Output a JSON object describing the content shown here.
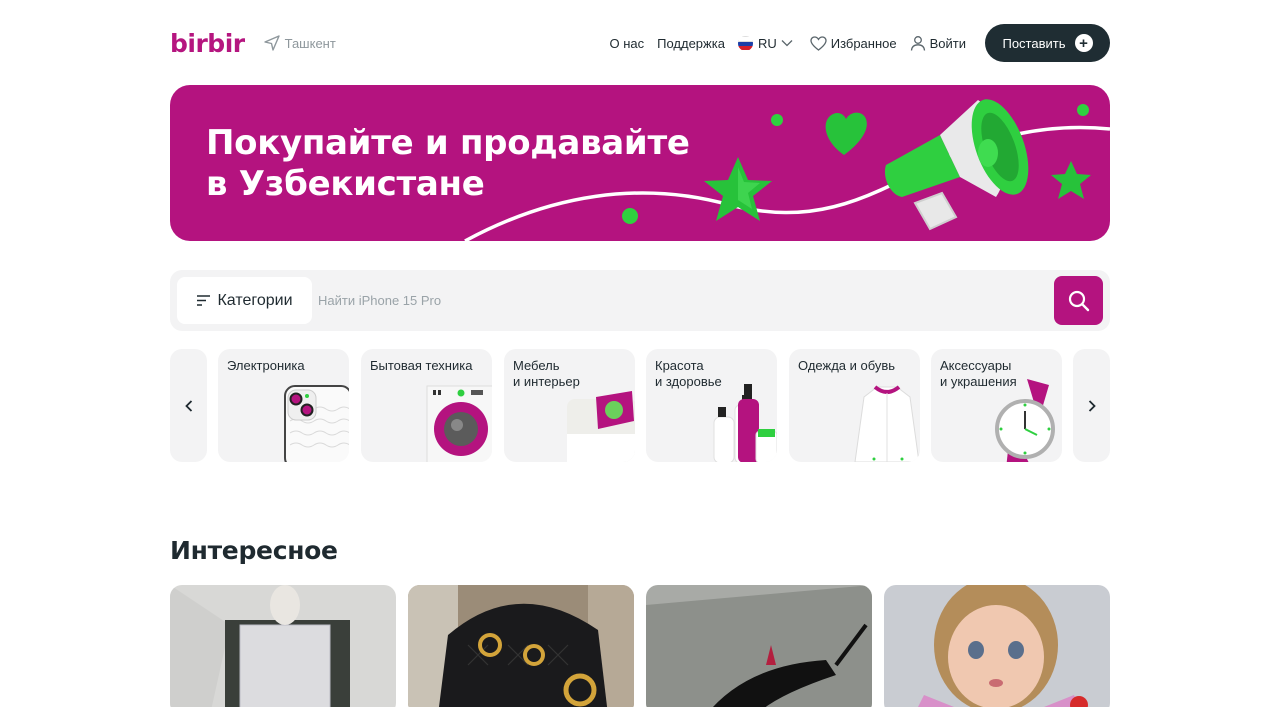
{
  "header": {
    "logo": "birbir",
    "location": "Ташкент",
    "nav_about": "О нас",
    "nav_support": "Поддержка",
    "lang": "RU",
    "favorites": "Избранное",
    "login": "Войти",
    "post_button": "Поставить"
  },
  "banner": {
    "title_line1": "Покупайте и продавайте",
    "title_line2": "в Узбекистане"
  },
  "search": {
    "categories_button": "Категории",
    "placeholder": "Найти iPhone 15 Pro"
  },
  "categories": [
    {
      "label": "Электроника"
    },
    {
      "label": "Бытовая техника"
    },
    {
      "label": "Мебель\nи интерьер"
    },
    {
      "label": "Красота\nи здоровье"
    },
    {
      "label": "Одежда и обувь"
    },
    {
      "label": "Аксессуары\nи украшения"
    }
  ],
  "interesting": {
    "title": "Интересное"
  },
  "colors": {
    "brand": "#b4137f",
    "accent_green": "#2ecc40",
    "dark_button": "#1f2d33"
  },
  "icons": [
    "location-arrow-icon",
    "ru-flag-icon",
    "chevron-down-icon",
    "heart-icon",
    "user-icon",
    "plus-icon",
    "menu-lines-icon",
    "search-icon",
    "chevron-left-icon",
    "chevron-right-icon"
  ]
}
